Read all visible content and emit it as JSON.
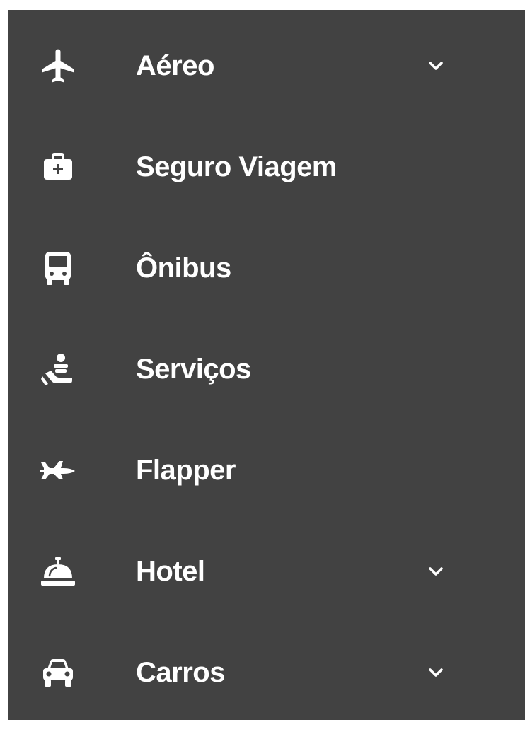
{
  "menu": {
    "items": [
      {
        "label": "Aéreo",
        "icon": "airplane-icon",
        "has_submenu": true
      },
      {
        "label": "Seguro Viagem",
        "icon": "medical-briefcase-icon",
        "has_submenu": false
      },
      {
        "label": "Ônibus",
        "icon": "bus-icon",
        "has_submenu": false
      },
      {
        "label": "Serviços",
        "icon": "hand-service-icon",
        "has_submenu": false
      },
      {
        "label": "Flapper",
        "icon": "jet-icon",
        "has_submenu": false
      },
      {
        "label": "Hotel",
        "icon": "concierge-bell-icon",
        "has_submenu": true
      },
      {
        "label": "Carros",
        "icon": "car-icon",
        "has_submenu": true
      }
    ]
  },
  "colors": {
    "background": "#424242",
    "foreground": "#ffffff"
  }
}
